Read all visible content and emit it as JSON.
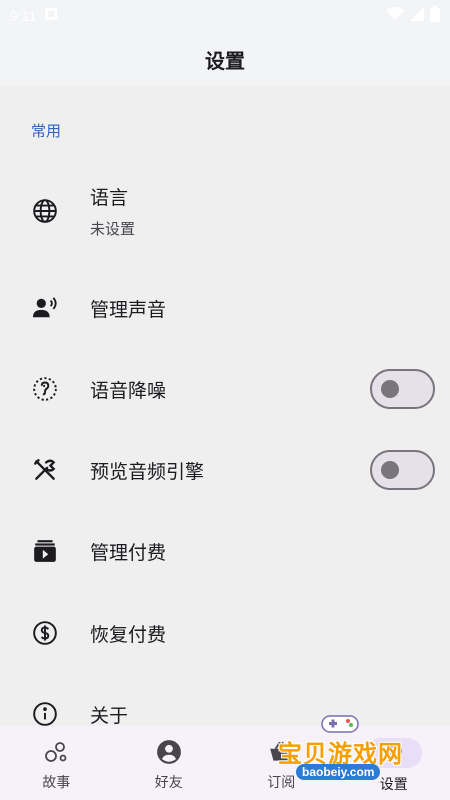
{
  "status_bar": {
    "time": "9:11",
    "icons": [
      "notification-icon",
      "wifi-icon",
      "signal-icon",
      "battery-icon"
    ]
  },
  "app_bar": {
    "title": "设置"
  },
  "section": {
    "header": "常用"
  },
  "settings": [
    {
      "icon": "globe-icon",
      "label": "语言",
      "sublabel": "未设置",
      "toggle": null
    },
    {
      "icon": "voice-icon",
      "label": "管理声音",
      "sublabel": null,
      "toggle": null
    },
    {
      "icon": "noise-reduction-icon",
      "label": "语音降噪",
      "sublabel": null,
      "toggle": false
    },
    {
      "icon": "tools-icon",
      "label": "预览音频引擎",
      "sublabel": null,
      "toggle": false
    },
    {
      "icon": "subscriptions-icon",
      "label": "管理付费",
      "sublabel": null,
      "toggle": null
    },
    {
      "icon": "dollar-icon",
      "label": "恢复付费",
      "sublabel": null,
      "toggle": null
    },
    {
      "icon": "info-icon",
      "label": "关于",
      "sublabel": null,
      "toggle": null
    }
  ],
  "bottom_nav": {
    "items": [
      {
        "icon": "bubbles-icon",
        "label": "故事",
        "active": false
      },
      {
        "icon": "account-icon",
        "label": "好友",
        "active": false
      },
      {
        "icon": "basket-icon",
        "label": "订阅",
        "active": false
      },
      {
        "icon": "settings-icon",
        "label": "设置",
        "active": true
      }
    ]
  },
  "watermark": {
    "text": "宝贝游戏网",
    "url": "baobeiy.com"
  },
  "colors": {
    "accent": "#2f64b8",
    "background": "#efefef",
    "bar_background": "#f3f4f6",
    "nav_background": "#f7f2fa",
    "active_pill": "#e8def8",
    "watermark_orange": "#f5a000"
  }
}
